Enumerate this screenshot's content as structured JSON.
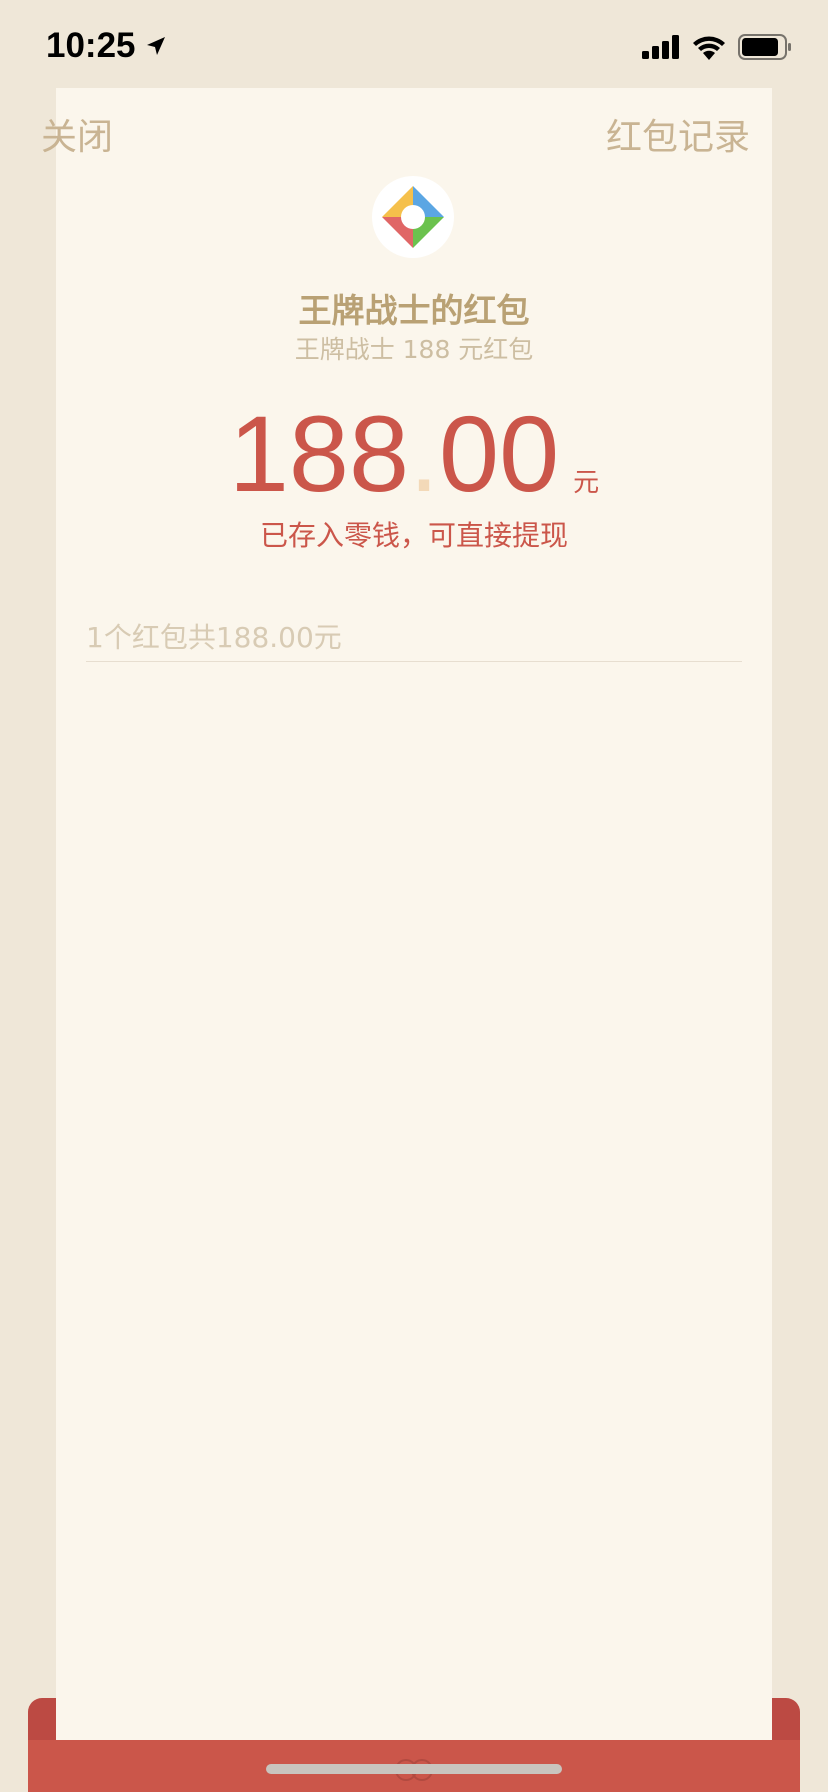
{
  "status_bar": {
    "time": "10:25",
    "icons": [
      "location-arrow-icon",
      "signal-icon",
      "wifi-icon",
      "battery-icon"
    ]
  },
  "nav": {
    "close_label": "关闭",
    "records_label": "红包记录"
  },
  "envelope": {
    "app_icon": "colorful-diamond-logo-icon",
    "title": "王牌战士的红包",
    "subtitle": "王牌战士 188 元红包",
    "amount_integer": "188",
    "amount_decimal_point": ".",
    "amount_decimal": "00",
    "amount_unit": "元",
    "saved_note": "已存入零钱，可直接提现",
    "summary": "1个红包共188.00元"
  },
  "colors": {
    "background": "#EFE7D8",
    "card": "#FBF6EC",
    "accent_red": "#CB564A",
    "gold_text": "#B9A174",
    "muted_text": "#C9B493"
  }
}
